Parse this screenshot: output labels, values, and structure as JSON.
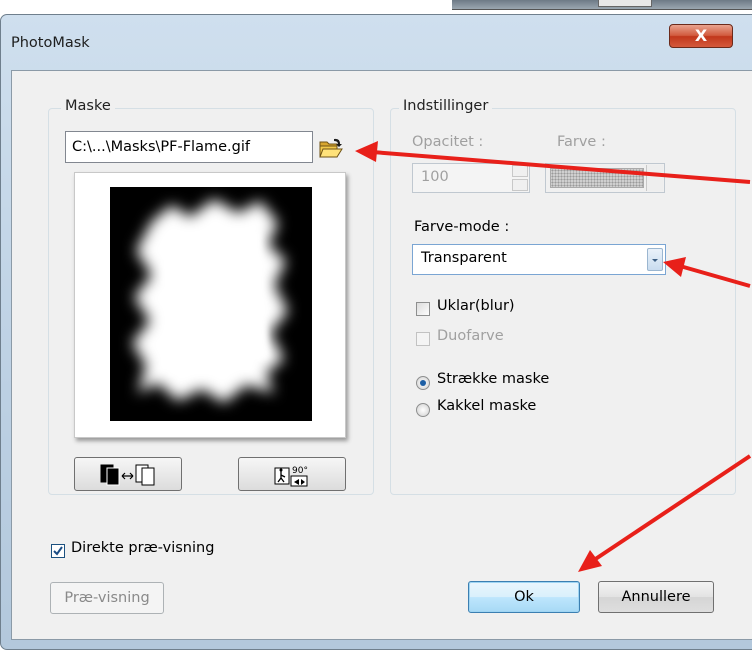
{
  "window": {
    "title": "PhotoMask",
    "close_label": "X"
  },
  "mask_group": {
    "label": "Maske",
    "path_value": "C:\\...\\Masks\\PF-Flame.gif",
    "browse_icon": "open-folder-icon",
    "invert_icon": "invert-mask-icon",
    "rotate_icon": "rotate-90-icon",
    "rotate_badge": "90°"
  },
  "settings_group": {
    "label": "Indstillinger",
    "opacity_label": "Opacitet :",
    "opacity_value": "100",
    "color_label": "Farve :",
    "color_mode_label": "Farve-mode :",
    "color_mode_value": "Transparent",
    "blur_label": "Uklar(blur)",
    "blur_checked": false,
    "duotone_label": "Duofarve",
    "duotone_enabled": false,
    "stretch_label": "Strække maske",
    "stretch_selected": true,
    "tile_label": "Kakkel maske",
    "tile_selected": false
  },
  "direct_preview": {
    "label": "Direkte præ-visning",
    "checked": true
  },
  "buttons": {
    "preview": "Præ-visning",
    "ok": "Ok",
    "cancel": "Annullere"
  },
  "colors": {
    "annotation_arrow": "#e8201a",
    "close_button": "#c74a2e",
    "dialog_face": "#f0f0f0"
  }
}
